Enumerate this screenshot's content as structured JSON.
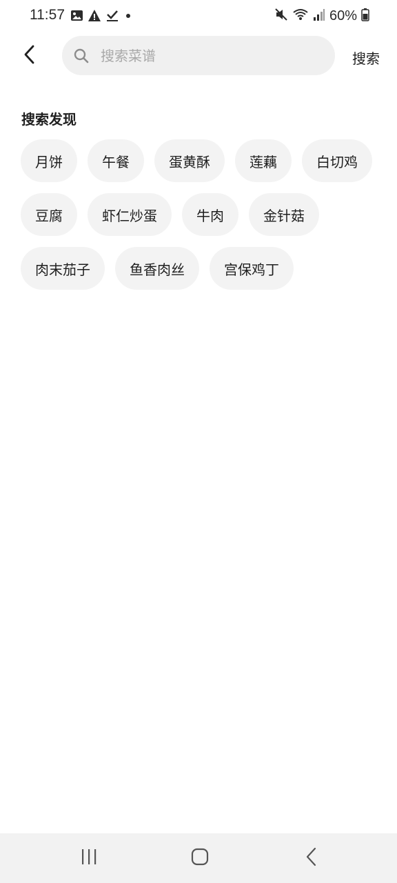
{
  "status_bar": {
    "time": "11:57",
    "battery": "60%",
    "icons": [
      "image-icon",
      "warning-icon",
      "check-icon",
      "dot-icon",
      "mute-icon",
      "wifi-icon",
      "signal-icon",
      "battery-icon"
    ]
  },
  "header": {
    "back_icon": "chevron-left-icon",
    "search_placeholder": "搜索菜谱",
    "search_value": "",
    "search_button_label": "搜索"
  },
  "discover": {
    "title": "搜索发现",
    "tags": [
      "月饼",
      "午餐",
      "蛋黄酥",
      "莲藕",
      "白切鸡",
      "豆腐",
      "虾仁炒蛋",
      "牛肉",
      "金针菇",
      "肉末茄子",
      "鱼香肉丝",
      "宫保鸡丁"
    ]
  },
  "nav_bar": {
    "buttons": [
      "recents-icon",
      "home-icon",
      "back-icon"
    ]
  },
  "colors": {
    "search_bg": "#f0f0f0",
    "chip_bg": "#f3f3f3",
    "nav_bg": "#f2f2f2",
    "text": "#1f1f1f",
    "placeholder": "#a9a9a9"
  }
}
